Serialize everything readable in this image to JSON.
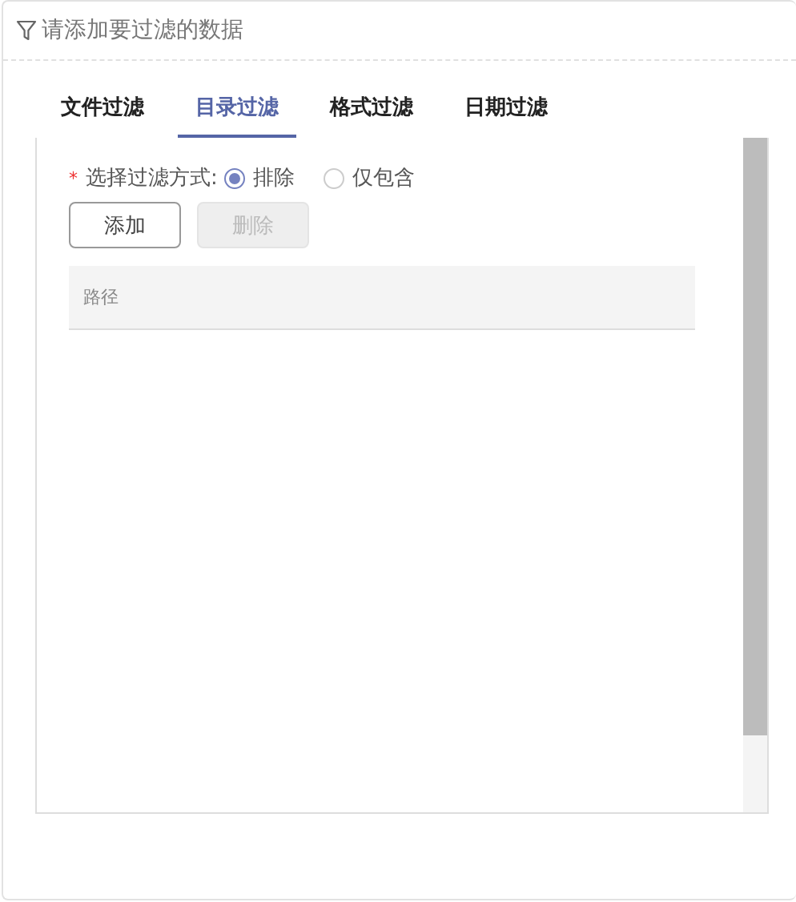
{
  "header": {
    "title": "请添加要过滤的数据"
  },
  "tabs": [
    {
      "label": "文件过滤",
      "selected": false
    },
    {
      "label": "目录过滤",
      "selected": true
    },
    {
      "label": "格式过滤",
      "selected": false
    },
    {
      "label": "日期过滤",
      "selected": false
    }
  ],
  "filter_mode": {
    "required_mark": "*",
    "label": "选择过滤方式:",
    "options": [
      {
        "label": "排除",
        "selected": true
      },
      {
        "label": "仅包含",
        "selected": false
      }
    ]
  },
  "buttons": [
    {
      "label": "添加",
      "disabled": false
    },
    {
      "label": "删除",
      "disabled": true
    }
  ],
  "table": {
    "columns": [
      "路径"
    ]
  }
}
